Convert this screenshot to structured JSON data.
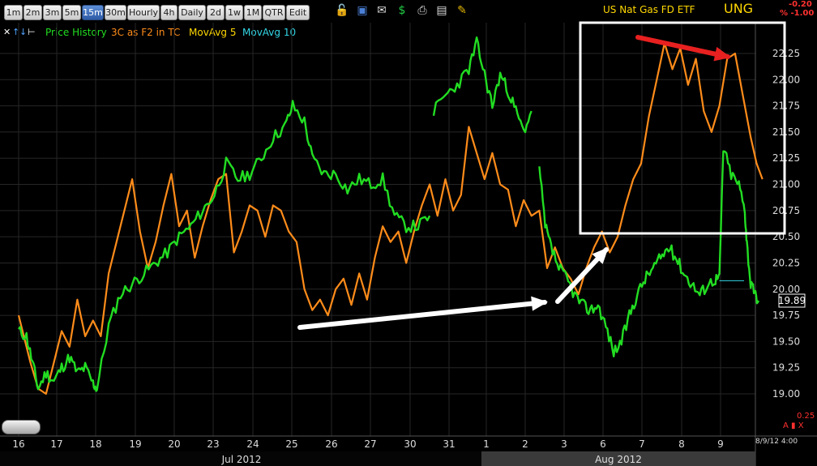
{
  "toolbar": {
    "timeframes": [
      "1m",
      "2m",
      "3m",
      "5m",
      "15m",
      "30m",
      "Hourly",
      "4h",
      "Daily",
      "2d",
      "1w",
      "1M",
      "QTR",
      "Edit"
    ],
    "active_timeframe": "15m",
    "icons": [
      "lock-icon",
      "save-icon",
      "email-icon",
      "dollar-icon",
      "print-icon",
      "screen-icon",
      "pencil-icon"
    ]
  },
  "legend": {
    "controls": [
      "close-icon",
      "arrow-up-icon",
      "arrow-down-icon",
      "settings-icon"
    ],
    "items": [
      {
        "label": "Price History",
        "color": "#22dd22"
      },
      {
        "label": "3C as F2 in TC",
        "color": "#ff8c1a"
      },
      {
        "label": "MovAvg 5",
        "color": "#ffd700"
      },
      {
        "label": "MovAvg 10",
        "color": "#33d6e6"
      }
    ]
  },
  "header": {
    "title": "US Nat Gas FD ETF",
    "ticker": "UNG",
    "change": "-0.20",
    "change_pct": "% -1.00"
  },
  "footer": {
    "secondary_value": "0.25",
    "axis_icons": "A ▮ X",
    "timestamp": "8/9/12 4:00"
  },
  "chart_data": {
    "type": "line",
    "x_labels": [
      "16",
      "17",
      "18",
      "19",
      "20",
      "23",
      "24",
      "25",
      "26",
      "27",
      "30",
      "31",
      "1",
      "2",
      "3",
      "6",
      "7",
      "8",
      "9"
    ],
    "months": [
      "Jul 2012",
      "Aug 2012"
    ],
    "y_ticks": [
      19.0,
      19.25,
      19.5,
      19.75,
      20.0,
      20.25,
      20.5,
      20.75,
      21.0,
      21.25,
      21.5,
      21.75,
      22.0,
      22.25
    ],
    "ylim": [
      18.78,
      22.45
    ],
    "last_price": "19.89",
    "series": [
      {
        "name": "Price History",
        "color": "#22dd22",
        "points": [
          [
            0,
            19.6
          ],
          [
            0.2,
            19.55
          ],
          [
            0.35,
            19.3
          ],
          [
            0.5,
            19.05
          ],
          [
            0.7,
            19.2
          ],
          [
            0.9,
            19.12
          ],
          [
            1.1,
            19.25
          ],
          [
            1.3,
            19.35
          ],
          [
            1.5,
            19.2
          ],
          [
            1.7,
            19.25
          ],
          [
            1.9,
            19.1
          ],
          [
            2.0,
            19.05
          ],
          [
            2.3,
            19.65
          ],
          [
            2.6,
            19.95
          ],
          [
            2.9,
            20.05
          ],
          [
            3.2,
            20.15
          ],
          [
            3.5,
            20.25
          ],
          [
            3.8,
            20.35
          ],
          [
            4.1,
            20.5
          ],
          [
            4.4,
            20.6
          ],
          [
            4.7,
            20.75
          ],
          [
            5.0,
            20.9
          ],
          [
            5.3,
            21.2
          ],
          [
            5.6,
            21.05
          ],
          [
            5.9,
            21.1
          ],
          [
            6.2,
            21.25
          ],
          [
            6.5,
            21.45
          ],
          [
            6.8,
            21.55
          ],
          [
            7.0,
            21.75
          ],
          [
            7.3,
            21.6
          ],
          [
            7.5,
            21.25
          ],
          [
            7.8,
            21.1
          ],
          [
            8.1,
            21.1
          ],
          [
            8.4,
            20.95
          ],
          [
            8.7,
            21.05
          ],
          [
            9.0,
            21.0
          ],
          [
            9.3,
            21.05
          ],
          [
            9.6,
            20.7
          ],
          [
            9.9,
            20.6
          ],
          [
            10.2,
            20.6
          ],
          [
            10.5,
            20.7
          ]
        ],
        "points2": [
          [
            10.6,
            21.7
          ],
          [
            10.9,
            21.85
          ],
          [
            11.2,
            21.95
          ],
          [
            11.5,
            22.1
          ],
          [
            11.7,
            22.35
          ],
          [
            11.9,
            22.05
          ],
          [
            12.1,
            21.75
          ],
          [
            12.3,
            22.05
          ],
          [
            12.5,
            21.9
          ],
          [
            12.7,
            21.7
          ],
          [
            12.9,
            21.5
          ],
          [
            13.1,
            21.7
          ]
        ],
        "points3": [
          [
            13.3,
            21.15
          ],
          [
            13.45,
            20.6
          ],
          [
            13.6,
            20.4
          ],
          [
            13.8,
            20.2
          ],
          [
            14.0,
            20.1
          ],
          [
            14.2,
            19.95
          ],
          [
            14.4,
            19.85
          ],
          [
            14.6,
            19.8
          ],
          [
            14.8,
            19.85
          ],
          [
            15.0,
            19.65
          ],
          [
            15.2,
            19.4
          ],
          [
            15.4,
            19.5
          ],
          [
            15.6,
            19.75
          ],
          [
            15.8,
            19.95
          ],
          [
            16.0,
            20.1
          ],
          [
            16.2,
            20.2
          ],
          [
            16.4,
            20.3
          ],
          [
            16.6,
            20.4
          ],
          [
            16.8,
            20.3
          ],
          [
            17.0,
            20.15
          ],
          [
            17.2,
            20.05
          ],
          [
            17.4,
            19.95
          ],
          [
            17.6,
            20.05
          ],
          [
            17.8,
            20.1
          ],
          [
            17.9,
            20.1
          ],
          [
            18.0,
            21.35
          ],
          [
            18.2,
            21.1
          ],
          [
            18.4,
            21.0
          ],
          [
            18.55,
            20.75
          ],
          [
            18.6,
            20.45
          ],
          [
            18.7,
            20.05
          ],
          [
            18.8,
            19.95
          ],
          [
            18.9,
            19.89
          ]
        ]
      },
      {
        "name": "3C as F2 in TC",
        "color": "#ff8c1a",
        "points": [
          [
            0,
            19.75
          ],
          [
            0.3,
            19.3
          ],
          [
            0.5,
            19.05
          ],
          [
            0.7,
            19.0
          ],
          [
            0.9,
            19.3
          ],
          [
            1.1,
            19.6
          ],
          [
            1.3,
            19.45
          ],
          [
            1.5,
            19.9
          ],
          [
            1.7,
            19.55
          ],
          [
            1.9,
            19.7
          ],
          [
            2.1,
            19.55
          ],
          [
            2.3,
            20.15
          ],
          [
            2.6,
            20.6
          ],
          [
            2.9,
            21.05
          ],
          [
            3.1,
            20.55
          ],
          [
            3.3,
            20.2
          ],
          [
            3.5,
            20.45
          ],
          [
            3.7,
            20.8
          ],
          [
            3.9,
            21.1
          ],
          [
            4.1,
            20.6
          ],
          [
            4.3,
            20.75
          ],
          [
            4.5,
            20.3
          ],
          [
            4.7,
            20.6
          ],
          [
            4.9,
            20.85
          ],
          [
            5.1,
            21.05
          ],
          [
            5.3,
            21.1
          ],
          [
            5.5,
            20.35
          ],
          [
            5.7,
            20.55
          ],
          [
            5.9,
            20.8
          ],
          [
            6.1,
            20.75
          ],
          [
            6.3,
            20.5
          ],
          [
            6.5,
            20.8
          ],
          [
            6.7,
            20.75
          ],
          [
            6.9,
            20.55
          ],
          [
            7.1,
            20.45
          ],
          [
            7.3,
            20.0
          ],
          [
            7.5,
            19.8
          ],
          [
            7.7,
            19.9
          ],
          [
            7.9,
            19.75
          ],
          [
            8.1,
            20.0
          ],
          [
            8.3,
            20.1
          ],
          [
            8.5,
            19.85
          ],
          [
            8.7,
            20.15
          ],
          [
            8.9,
            19.9
          ],
          [
            9.1,
            20.3
          ],
          [
            9.3,
            20.6
          ],
          [
            9.5,
            20.45
          ],
          [
            9.7,
            20.55
          ],
          [
            9.9,
            20.25
          ],
          [
            10.1,
            20.55
          ],
          [
            10.3,
            20.8
          ],
          [
            10.5,
            21.0
          ],
          [
            10.7,
            20.7
          ],
          [
            10.9,
            21.05
          ],
          [
            11.1,
            20.75
          ],
          [
            11.3,
            20.9
          ],
          [
            11.5,
            21.55
          ],
          [
            11.7,
            21.3
          ],
          [
            11.9,
            21.05
          ],
          [
            12.1,
            21.3
          ],
          [
            12.3,
            21.0
          ],
          [
            12.5,
            20.95
          ],
          [
            12.7,
            20.6
          ],
          [
            12.9,
            20.85
          ],
          [
            13.1,
            20.7
          ],
          [
            13.3,
            20.75
          ],
          [
            13.5,
            20.2
          ],
          [
            13.7,
            20.4
          ],
          [
            13.9,
            20.2
          ],
          [
            14.1,
            20.1
          ],
          [
            14.3,
            19.95
          ],
          [
            14.5,
            20.2
          ],
          [
            14.7,
            20.4
          ],
          [
            14.9,
            20.55
          ],
          [
            15.1,
            20.35
          ],
          [
            15.3,
            20.5
          ],
          [
            15.5,
            20.8
          ],
          [
            15.7,
            21.05
          ],
          [
            15.9,
            21.2
          ],
          [
            16.1,
            21.65
          ],
          [
            16.3,
            22.0
          ],
          [
            16.5,
            22.35
          ],
          [
            16.7,
            22.1
          ],
          [
            16.9,
            22.3
          ],
          [
            17.1,
            21.95
          ],
          [
            17.3,
            22.2
          ],
          [
            17.5,
            21.7
          ],
          [
            17.7,
            21.5
          ],
          [
            17.9,
            21.75
          ],
          [
            18.1,
            22.2
          ],
          [
            18.3,
            22.25
          ],
          [
            18.5,
            21.85
          ],
          [
            18.7,
            21.45
          ],
          [
            18.85,
            21.2
          ],
          [
            19.0,
            21.05
          ]
        ]
      }
    ]
  }
}
